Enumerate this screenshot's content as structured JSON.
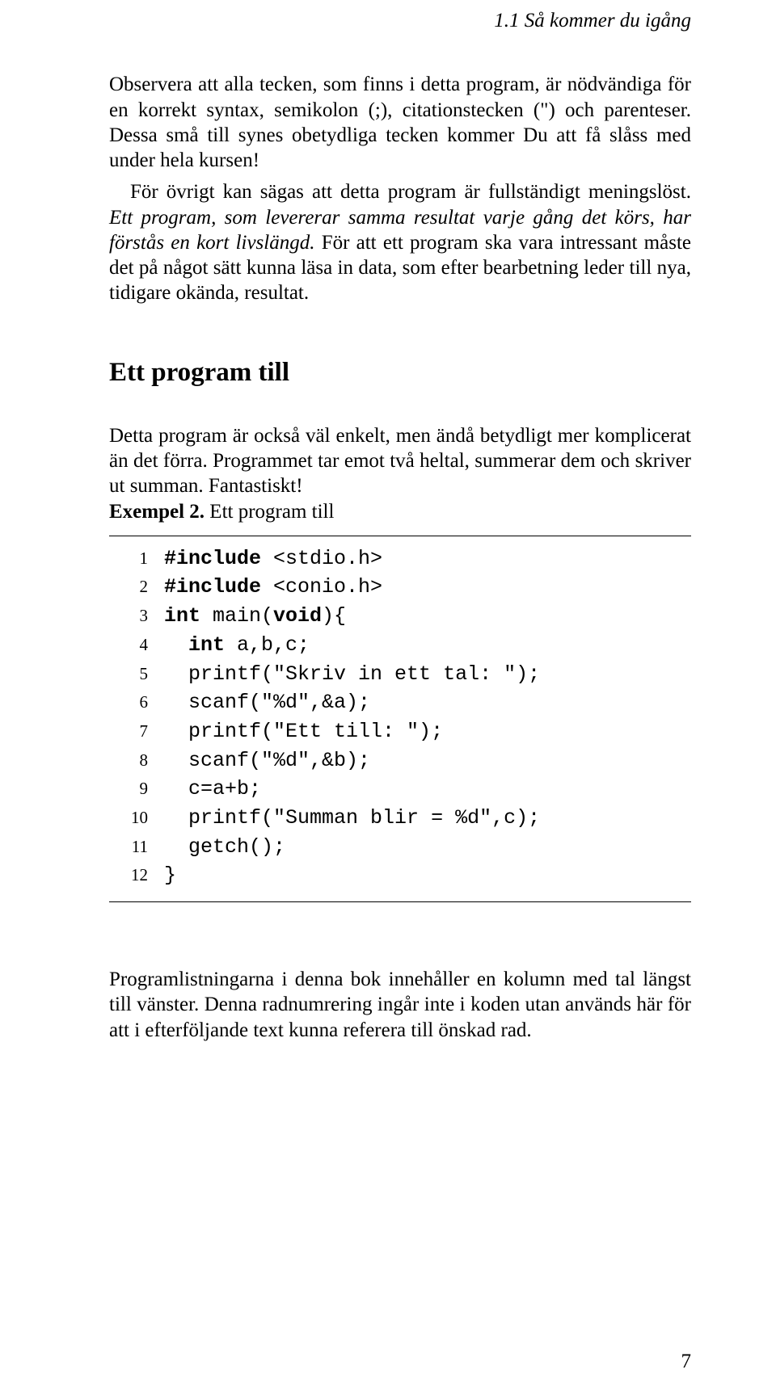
{
  "running_head": "1.1  Så kommer du igång",
  "p1": "Observera att alla tecken, som finns i detta program, är nödvändiga för en korrekt syntax, semikolon (;), citationstecken (\") och parenteser. Dessa små till synes obetydliga tecken kommer Du att få slåss med under hela kursen!",
  "p2a": "För övrigt kan sägas att detta program är fullständigt meningslöst. ",
  "p2b_italic": "Ett program, som levererar samma resultat varje gång det körs, har förstås en kort livslängd.",
  "p2c": " För att ett program ska vara intressant måste det på något sätt kunna läsa in data, som efter bearbetning leder till nya, tidigare okända, resultat.",
  "h2": "Ett program till",
  "p3": "Detta program är också väl enkelt, men ändå betydligt mer komplicerat än det förra. Programmet tar emot två heltal, summerar dem och skriver ut summan. Fantastiskt!",
  "example_label": "Exempel 2.",
  "example_title": " Ett program till",
  "code": [
    {
      "n": "1",
      "indent": 0,
      "segs": [
        {
          "t": "#include",
          "k": true
        },
        {
          "t": " <stdio.h>"
        }
      ]
    },
    {
      "n": "2",
      "indent": 0,
      "segs": [
        {
          "t": "#include",
          "k": true
        },
        {
          "t": " <conio.h>"
        }
      ]
    },
    {
      "n": "3",
      "indent": 0,
      "segs": [
        {
          "t": "int",
          "k": true
        },
        {
          "t": " main("
        },
        {
          "t": "void",
          "k": true
        },
        {
          "t": "){"
        }
      ]
    },
    {
      "n": "4",
      "indent": 1,
      "segs": [
        {
          "t": "int",
          "k": true
        },
        {
          "t": " a,b,c;"
        }
      ]
    },
    {
      "n": "5",
      "indent": 1,
      "segs": [
        {
          "t": "printf(\"Skriv in ett tal: \");"
        }
      ]
    },
    {
      "n": "6",
      "indent": 1,
      "segs": [
        {
          "t": "scanf(\"%d\",&a);"
        }
      ]
    },
    {
      "n": "7",
      "indent": 1,
      "segs": [
        {
          "t": "printf(\"Ett till: \");"
        }
      ]
    },
    {
      "n": "8",
      "indent": 1,
      "segs": [
        {
          "t": "scanf(\"%d\",&b);"
        }
      ]
    },
    {
      "n": "9",
      "indent": 1,
      "segs": [
        {
          "t": "c=a+b;"
        }
      ]
    },
    {
      "n": "10",
      "indent": 1,
      "segs": [
        {
          "t": "printf(\"Summan blir = %d\",c);"
        }
      ]
    },
    {
      "n": "11",
      "indent": 1,
      "segs": [
        {
          "t": "getch();"
        }
      ]
    },
    {
      "n": "12",
      "indent": 0,
      "segs": [
        {
          "t": "}"
        }
      ]
    }
  ],
  "p4": "Programlistningarna i denna bok innehåller en kolumn med tal längst till vänster. Denna radnumrering ingår inte i koden utan används här för att i efterföljande text kunna referera till önskad rad.",
  "page_number": "7"
}
